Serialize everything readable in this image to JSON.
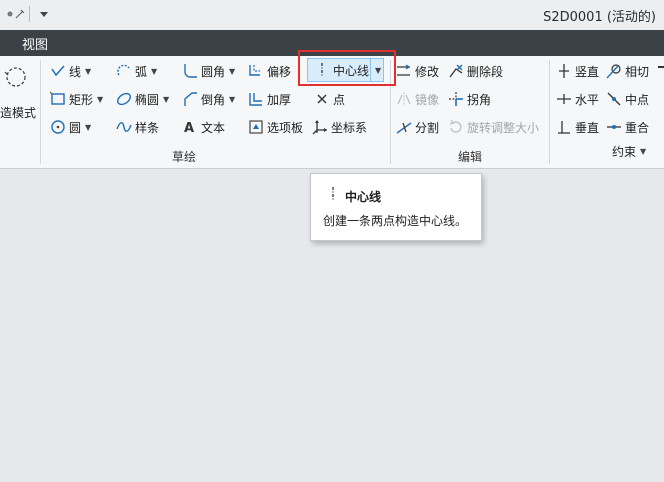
{
  "window": {
    "title": "S2D0001 (活动的)"
  },
  "tabs": [
    {
      "label": "视图"
    }
  ],
  "ribbon": {
    "partial_left_label": "造模式",
    "sketch_group": {
      "label": "草绘",
      "col1": [
        {
          "label": "线",
          "icon": "line-icon",
          "dropdown": true
        },
        {
          "label": "矩形",
          "icon": "rectangle-icon",
          "dropdown": true
        },
        {
          "label": "圆",
          "icon": "circle-icon",
          "dropdown": true
        }
      ],
      "col2": [
        {
          "label": "弧",
          "icon": "arc-icon",
          "dropdown": true
        },
        {
          "label": "椭圆",
          "icon": "ellipse-icon",
          "dropdown": true
        },
        {
          "label": "样条",
          "icon": "spline-icon",
          "dropdown": false
        }
      ],
      "col3": [
        {
          "label": "圆角",
          "icon": "fillet-icon",
          "dropdown": true
        },
        {
          "label": "倒角",
          "icon": "chamfer-icon",
          "dropdown": true
        },
        {
          "label": "文本",
          "icon": "text-icon",
          "dropdown": false
        }
      ],
      "col4": [
        {
          "label": "偏移",
          "icon": "offset-icon"
        },
        {
          "label": "加厚",
          "icon": "thicken-icon"
        },
        {
          "label": "选项板",
          "icon": "palette-icon"
        }
      ],
      "col5": [
        {
          "label": "中心线",
          "icon": "centerline-icon",
          "dropdown": true
        },
        {
          "label": "点",
          "icon": "point-icon"
        },
        {
          "label": "坐标系",
          "icon": "coordinate-system-icon"
        }
      ]
    },
    "edit_group": {
      "label": "编辑",
      "items": [
        {
          "label": "修改",
          "icon": "modify-icon",
          "disabled": false
        },
        {
          "label": "删除段",
          "icon": "delete-segment-icon",
          "disabled": false
        },
        {
          "label": "镜像",
          "icon": "mirror-icon",
          "disabled": true
        },
        {
          "label": "拐角",
          "icon": "corner-icon",
          "disabled": false
        },
        {
          "label": "分割",
          "icon": "divide-icon",
          "disabled": false
        },
        {
          "label": "旋转调整大小",
          "icon": "rotate-resize-icon",
          "disabled": true
        }
      ]
    },
    "constraints_group": {
      "label": "约束",
      "dropdown": true,
      "items": [
        {
          "label": "竖直",
          "icon": "vertical-icon"
        },
        {
          "label": "相切",
          "icon": "tangent-icon"
        },
        {
          "label": "水平",
          "icon": "horizontal-icon"
        },
        {
          "label": "中点",
          "icon": "midpoint-icon"
        },
        {
          "label": "垂直",
          "icon": "perpendicular-icon"
        },
        {
          "label": "重合",
          "icon": "coincident-icon"
        }
      ]
    }
  },
  "tooltip": {
    "title": "中心线",
    "description": "创建一条两点构造中心线。",
    "icon": "centerline-icon"
  },
  "colors": {
    "highlight_border": "#e2302c",
    "tab_bar": "#3a4147",
    "accent_blue": "#1f6fb8",
    "hover_fill": "#d8ecfa"
  }
}
